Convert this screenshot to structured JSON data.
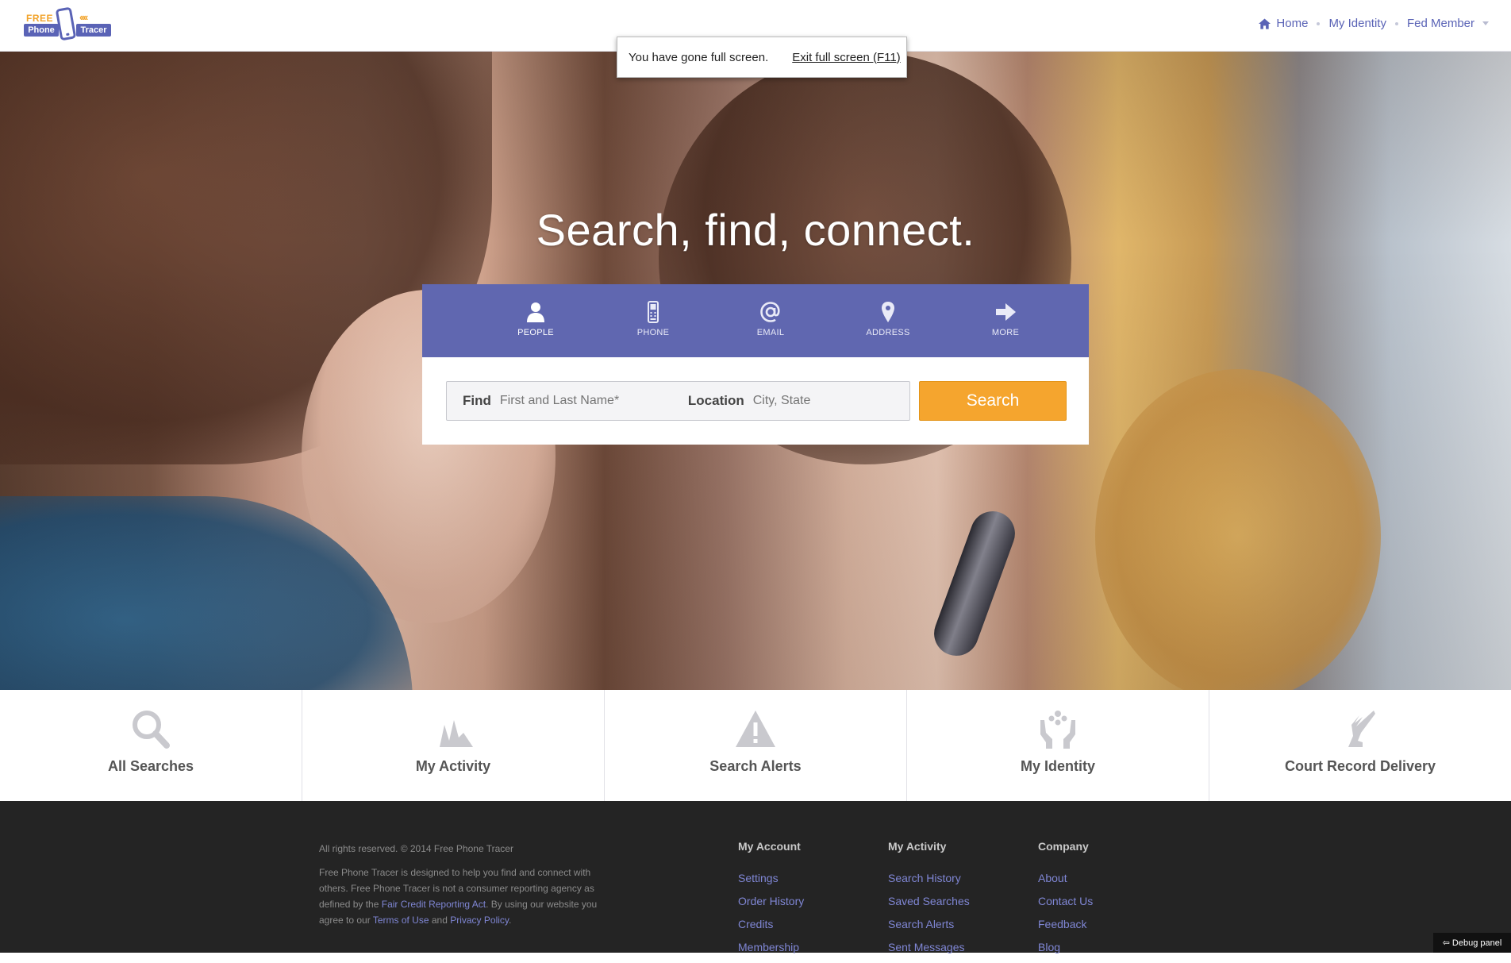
{
  "logo": {
    "free": "FREE",
    "phone": "Phone",
    "chevrons": "‹‹‹‹",
    "tracer": "Tracer"
  },
  "nav": {
    "home": "Home",
    "identity": "My Identity",
    "member": "Fed Member"
  },
  "fullscreen": {
    "message": "You have gone full screen.",
    "exit": "Exit full screen (F11)"
  },
  "hero": {
    "headline": "Search, find, connect."
  },
  "tabs": [
    {
      "label": "PEOPLE",
      "icon": "person-icon"
    },
    {
      "label": "PHONE",
      "icon": "phone-icon"
    },
    {
      "label": "EMAIL",
      "icon": "at-icon"
    },
    {
      "label": "ADDRESS",
      "icon": "map-pin-icon"
    },
    {
      "label": "MORE",
      "icon": "arrow-right-icon"
    }
  ],
  "search": {
    "find_label": "Find",
    "find_placeholder": "First and Last Name*",
    "location_label": "Location",
    "location_placeholder": "City, State",
    "button": "Search"
  },
  "features": [
    {
      "label": "All Searches",
      "icon": "magnifier-icon"
    },
    {
      "label": "My Activity",
      "icon": "activity-icon"
    },
    {
      "label": "Search Alerts",
      "icon": "warning-icon"
    },
    {
      "label": "My Identity",
      "icon": "hands-icon"
    },
    {
      "label": "Court Record Delivery",
      "icon": "winged-foot-icon"
    }
  ],
  "footer": {
    "copyright": "All rights reserved. © 2014 Free Phone Tracer",
    "about_pre": "Free Phone Tracer is designed to help you find and connect with others. Free Phone Tracer is not a consumer reporting agency as defined by the ",
    "fcra_link": "Fair Credit Reporting Act",
    "about_mid": ". By using our website you agree to our ",
    "terms_link": "Terms of Use",
    "about_and": " and ",
    "privacy_link": "Privacy Policy",
    "about_end": ".",
    "columns": [
      {
        "title": "My Account",
        "links": [
          "Settings",
          "Order History",
          "Credits",
          "Membership"
        ]
      },
      {
        "title": "My Activity",
        "links": [
          "Search History",
          "Saved Searches",
          "Search Alerts",
          "Sent Messages"
        ]
      },
      {
        "title": "Company",
        "links": [
          "About",
          "Contact Us",
          "Feedback",
          "Blog"
        ]
      }
    ]
  },
  "debug": "⇦ Debug panel",
  "colors": {
    "accent": "#6067b0",
    "button": "#f5a52e",
    "footer": "#242424",
    "link": "#7f86d4"
  }
}
